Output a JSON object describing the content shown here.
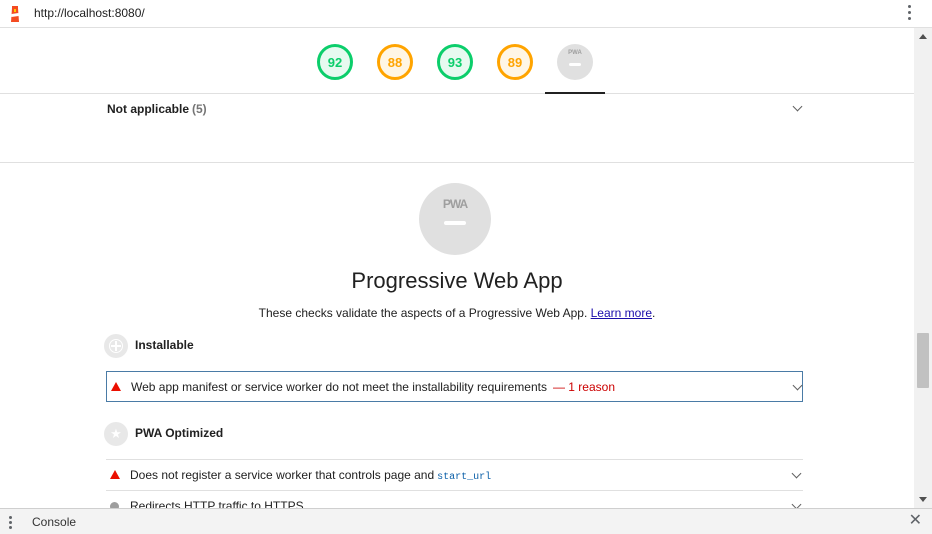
{
  "browser": {
    "url": "http://localhost:8080/",
    "logo_icon": "lighthouse-icon",
    "menu_icon": "kebab-menu-icon"
  },
  "header_gauges": [
    {
      "score": "92",
      "status": "pass"
    },
    {
      "score": "88",
      "status": "average"
    },
    {
      "score": "93",
      "status": "pass"
    },
    {
      "score": "89",
      "status": "average"
    },
    {
      "score": "PWA",
      "status": "pwa",
      "active": true
    }
  ],
  "not_applicable": {
    "label": "Not applicable",
    "count": "(5)"
  },
  "category": {
    "gauge_text": "PWA",
    "title": "Progressive Web App",
    "description": "These checks validate the aspects of a Progressive Web App.",
    "learn_more": "Learn more",
    "period": "."
  },
  "groups": {
    "installable": {
      "label": "Installable",
      "icon": "plus-circle-icon",
      "audits": [
        {
          "status": "fail",
          "text": "Web app manifest or service worker do not meet the installability requirements",
          "reason": "— 1 reason"
        }
      ]
    },
    "pwa_optimized": {
      "label": "PWA Optimized",
      "icon": "star-icon",
      "audits": [
        {
          "status": "fail",
          "text": "Does not register a service worker that controls page and",
          "code": "start_url"
        },
        {
          "status": "neutral",
          "text": "Redirects HTTP traffic to HTTPS"
        }
      ]
    }
  },
  "console": {
    "label": "Console",
    "close_glyph": "✕"
  },
  "colors": {
    "pass": "#0cce6b",
    "average": "#ffa400",
    "fail": "#eb0f00",
    "link": "#1a0dab"
  }
}
